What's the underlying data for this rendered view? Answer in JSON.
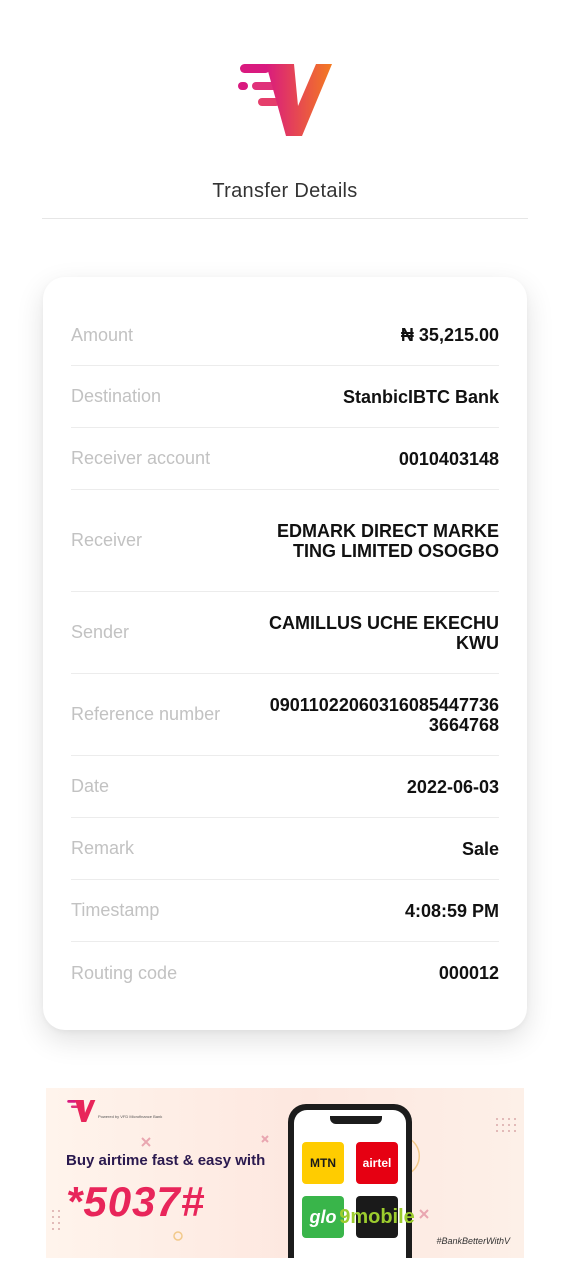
{
  "header": {
    "title": "Transfer Details",
    "brand_colors": {
      "magenta": "#d91a7f",
      "orange": "#f47b20",
      "pink": "#e8255a"
    }
  },
  "details": [
    {
      "label": "Amount",
      "value": "₦ 35,215.00"
    },
    {
      "label": "Destination",
      "value": "StanbicIBTC Bank"
    },
    {
      "label": "Receiver account",
      "value": "0010403148"
    },
    {
      "label": "Receiver",
      "value": "EDMARK DIRECT MARKETING LIMITED OSOGBO"
    },
    {
      "label": "Sender",
      "value": "CAMILLUS UCHE EKECHUKWU"
    },
    {
      "label": "Reference number",
      "value": "090110220603160854477363664768"
    },
    {
      "label": "Date",
      "value": "2022-06-03"
    },
    {
      "label": "Remark",
      "value": "Sale"
    },
    {
      "label": "Timestamp",
      "value": "4:08:59 PM"
    },
    {
      "label": "Routing code",
      "value": "000012"
    }
  ],
  "banner": {
    "powered_by": "Powered by VFD Microfinance Bank",
    "headline": "Buy airtime fast & easy with",
    "ussd_code": "*5037#",
    "hashtag": "#BankBetterWithV",
    "networks": [
      {
        "name": "MTN",
        "icon": "mtn-logo"
      },
      {
        "name": "airtel",
        "icon": "airtel-logo"
      },
      {
        "name": "glo",
        "icon": "glo-logo"
      },
      {
        "name": "9mobile",
        "icon": "9mobile-logo"
      }
    ]
  }
}
